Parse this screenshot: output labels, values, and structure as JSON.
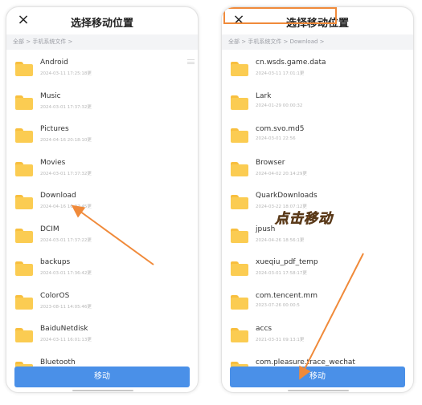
{
  "left_panel": {
    "close_icon": "×",
    "title": "选择移动位置",
    "breadcrumb": "全部 > 手机系统文件 >",
    "folders": [
      {
        "name": "Android",
        "date": "2024-03-11 17:25:18更"
      },
      {
        "name": "Music",
        "date": "2024-03-01 17:37:32更"
      },
      {
        "name": "Pictures",
        "date": "2024-04-16 20:18:10更"
      },
      {
        "name": "Movies",
        "date": "2024-03-01 17:37:32更"
      },
      {
        "name": "Download",
        "date": "2024-04-16 16:07:45更"
      },
      {
        "name": "DCIM",
        "date": "2024-03-01 17:37:22更"
      },
      {
        "name": "backups",
        "date": "2024-03-01 17:36:42更"
      },
      {
        "name": "ColorOS",
        "date": "2023-08-11 14:05:46更"
      },
      {
        "name": "BaiduNetdisk",
        "date": "2024-03-11 16:01:13更"
      },
      {
        "name": "Bluetooth",
        "date": ""
      }
    ],
    "move_button": "移动"
  },
  "right_panel": {
    "close_icon": "×",
    "title": "选择移动位置",
    "breadcrumb": "全部 > 手机系统文件 > Download >",
    "folders": [
      {
        "name": "cn.wsds.game.data",
        "date": "2024-03-11 17:01:1更"
      },
      {
        "name": "Lark",
        "date": "2024-01-29 00:00:32"
      },
      {
        "name": "com.svo.md5",
        "date": "2024-03-01 22:56"
      },
      {
        "name": "Browser",
        "date": "2024-04-02 20:14:29更"
      },
      {
        "name": "QuarkDownloads",
        "date": "2024-03-22 18:07:12更"
      },
      {
        "name": "jpush",
        "date": "2024-04-26 18:56:1更"
      },
      {
        "name": "xueqiu_pdf_temp",
        "date": "2024-03-01 17:58:17更"
      },
      {
        "name": "com.tencent.mm",
        "date": "2023-07-26 00:00:5"
      },
      {
        "name": "accs",
        "date": "2021-03-31 09:13:1更"
      },
      {
        "name": "com.pleasure.trace_wechat",
        "date": ""
      }
    ],
    "move_button": "移动"
  },
  "annotation": "点击移动",
  "colors": {
    "accent_blue": "#4a90e8",
    "highlight_orange": "#f08a3a",
    "folder_yellow": "#fbcc52"
  }
}
